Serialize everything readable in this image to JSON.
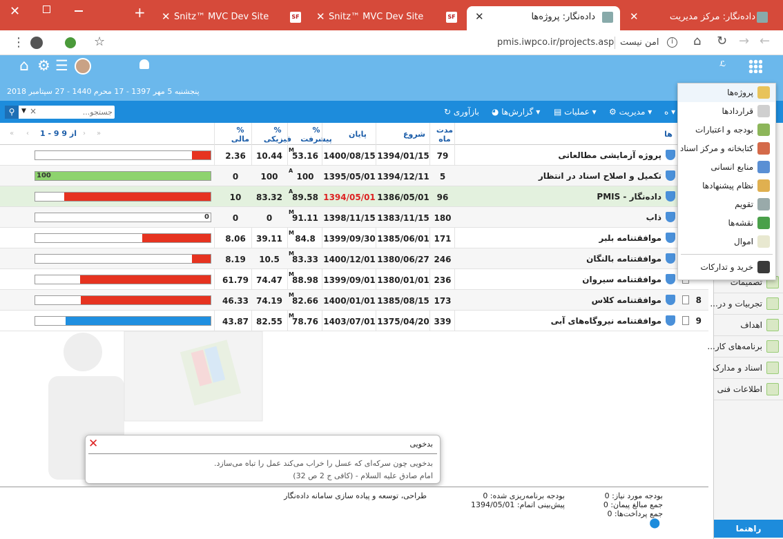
{
  "browser": {
    "tabs": [
      {
        "title": "داده‌نگار: مرکز مدیریت"
      },
      {
        "title": "داده‌نگار: پروژه‌ها"
      },
      {
        "title": "Snitz™ MVC Dev Site"
      },
      {
        "title": "Snitz™ MVC Dev Site"
      }
    ],
    "security_label": "امن نیست",
    "url": "pmis.iwpco.ir/projects.asp"
  },
  "header": {
    "date": "پنجشنبه 5 مهر 1397 - 17 محرم 1440 - 27 سپتامبر 2018"
  },
  "toolbar": {
    "b1": "ه",
    "management": "مدیریت",
    "operations": "عملیات",
    "reports": "گزارش‌ها",
    "reload": "بازآوری",
    "search_placeholder": "جستجو...",
    "search_clear": "×"
  },
  "grid": {
    "headers": {
      "name": "ها",
      "duration": "مدت\nماه",
      "start": "شروع",
      "end": "پایان",
      "progress": "%\nپیشرفت",
      "physical": "%\nفیزیکی",
      "financial": "%\nمالی"
    },
    "pager": "1 - 9 از 9",
    "rows": [
      {
        "idx": "",
        "name": "پروژه آزمایشی مطالعاتی",
        "duration": "79",
        "start": "1394/01/15",
        "end": "1400/08/15",
        "badge": "M",
        "progress": "53.16",
        "physical": "10.44",
        "financial": "2.36",
        "bar": 10.44,
        "bar_label": "10.44",
        "bar_color": "#e63320"
      },
      {
        "idx": "",
        "name": "تکمیل و اصلاح اسناد در انتظار",
        "duration": "5",
        "start": "1394/12/11",
        "end": "1395/05/01",
        "badge": "A",
        "progress": "100",
        "physical": "100",
        "financial": "0",
        "bar": 100,
        "bar_label": "100",
        "bar_color": "#8ed36e"
      },
      {
        "idx": "",
        "name": "داده‌نگار - PMIS",
        "duration": "96",
        "start": "1386/05/01",
        "end": "1394/05/01",
        "badge": "A",
        "progress": "89.58",
        "physical": "83.32",
        "financial": "10",
        "bar": 83.32,
        "bar_label": "83.32",
        "bar_color": "#e63320"
      },
      {
        "idx": "",
        "name": "ذاب",
        "duration": "180",
        "start": "1383/11/15",
        "end": "1398/11/15",
        "badge": "M",
        "progress": "91.11",
        "physical": "0",
        "financial": "0",
        "bar": 0,
        "bar_label": "0",
        "bar_color": "#e63320"
      },
      {
        "idx": "",
        "name": "موافقتنامه بلبر",
        "duration": "171",
        "start": "1385/06/01",
        "end": "1399/09/30",
        "badge": "M",
        "progress": "84.8",
        "physical": "39.11",
        "financial": "8.06",
        "bar": 39.11,
        "bar_label": "39.11",
        "bar_color": "#e63320"
      },
      {
        "idx": "",
        "name": "موافقتنامه بالنگان",
        "duration": "246",
        "start": "1380/06/27",
        "end": "1400/12/01",
        "badge": "M",
        "progress": "83.33",
        "physical": "10.5",
        "financial": "8.19",
        "bar": 10.5,
        "bar_label": "10.5",
        "bar_color": "#e63320"
      },
      {
        "idx": "",
        "name": "موافقتنامه سیروان",
        "duration": "236",
        "start": "1380/01/01",
        "end": "1399/09/01",
        "badge": "M",
        "progress": "88.98",
        "physical": "74.47",
        "financial": "61.79",
        "bar": 74.47,
        "bar_label": "74.47",
        "bar_color": "#e63320"
      },
      {
        "idx": "8",
        "name": "موافقتنامه کلاس",
        "duration": "173",
        "start": "1385/08/15",
        "end": "1400/01/01",
        "badge": "M",
        "progress": "82.66",
        "physical": "74.19",
        "financial": "46.33",
        "bar": 74.19,
        "bar_label": "74.19",
        "bar_color": "#e63320"
      },
      {
        "idx": "9",
        "name": "موافقتنامه نیروگاه‌های آبی",
        "duration": "339",
        "start": "1375/04/20",
        "end": "1403/07/01",
        "badge": "M",
        "progress": "78.76",
        "physical": "82.55",
        "financial": "43.87",
        "bar": 82.55,
        "bar_label": "82.55",
        "bar_color": "#1f8fe0"
      }
    ]
  },
  "menu": {
    "items": [
      "پروژه‌ها",
      "قراردادها",
      "بودجه و اعتبارات",
      "کتابخانه و مرکز اسناد",
      "منابع انسانی",
      "نظام پیشنهادها",
      "تقویم",
      "نقشه‌ها",
      "اموال",
      "خرید و تدارکات"
    ]
  },
  "sidebar": {
    "items": [
      "تصمیمات",
      "تجربیات و در...",
      "اهداف",
      "برنامه‌های کار...",
      "اسناد و مدارک",
      "اطلاعات فنی"
    ],
    "help": "راهنما"
  },
  "popup": {
    "title": "بدخویی",
    "line1": "بدخویی چون سرکه‌ای که عسل را خراب می‌کند عمل را تباه می‌سازد.",
    "line2": "امام صادق علیه السلام - (کافی ج 2 ص 32)"
  },
  "footer": {
    "budget_needed": "بودجه مورد نیاز: 0",
    "contracts_total": "جمع مبالغ پیمان: 0",
    "payments_total": "جمع پرداخت‌ها: 0",
    "budget_planned": "بودجه برنامه‌ریزی شده: 0",
    "forecast_end": "پیش‌بینی اتمام: 1394/05/01",
    "credit": "طراحی، توسعه و پیاده سازی سامانه داده‌نگار"
  }
}
